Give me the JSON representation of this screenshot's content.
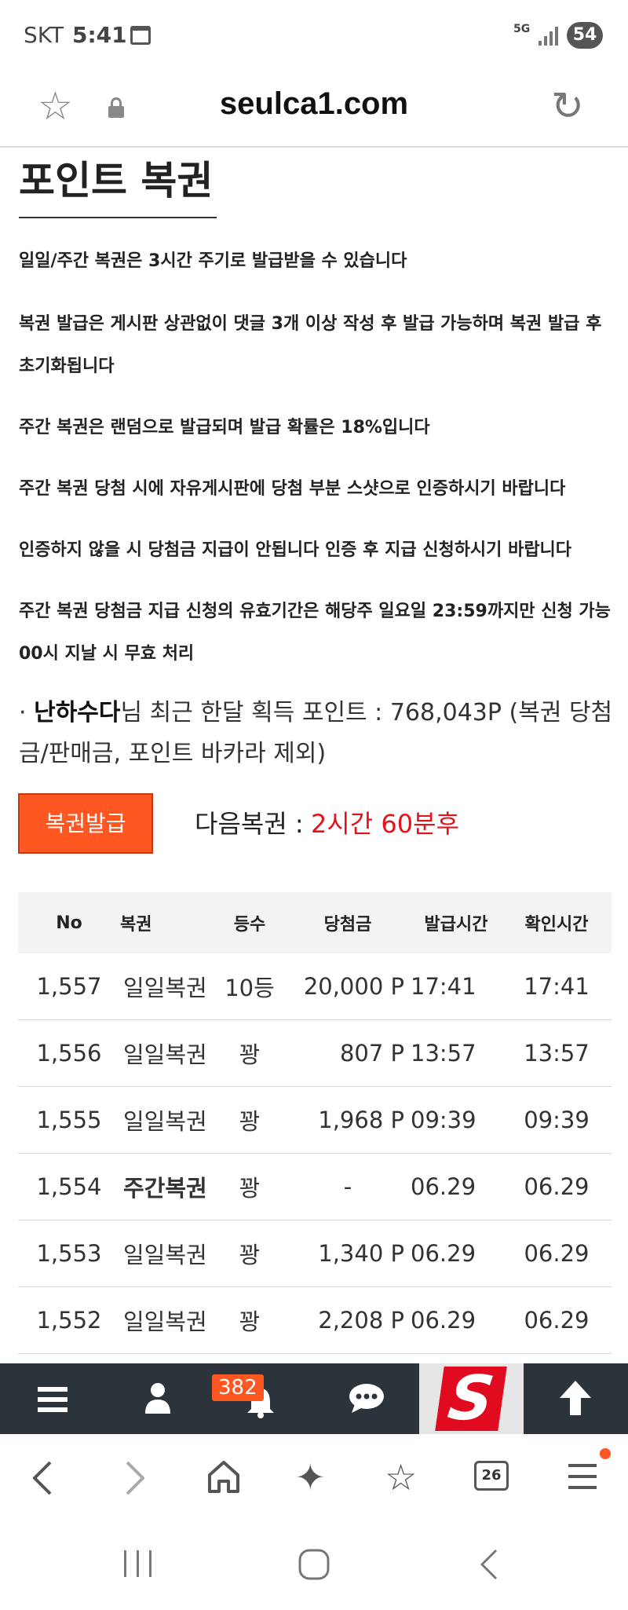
{
  "status": {
    "carrier": "SKT",
    "time": "5:41",
    "network": "5G",
    "battery": "54"
  },
  "browser": {
    "url": "seulca1.com"
  },
  "page": {
    "title": "포인트 복권",
    "notices": [
      "일일/주간 복권은 3시간 주기로 발급받을 수 있습니다",
      "복권 발급은 게시판 상관없이 댓글 3개 이상 작성 후 발급 가능하며 복권 발급 후 초기화됩니다",
      "주간 복권은 랜덤으로 발급되며 발급 확률은 18%입니다",
      "주간 복권 당첨 시에 자유게시판에 당첨 부분 스샷으로 인증하시기 바랍니다",
      "인증하지 않을 시 당첨금 지급이 안됩니다 인증 후 지급 신청하시기 바랍니다",
      "주간 복권 당첨금 지급 신청의 유효기간은 해당주 일요일 23:59까지만 신청 가능 00시 지날 시 무효 처리"
    ],
    "points": {
      "bullet": "·",
      "username": "난하수다",
      "text": "님 최근 한달 획득 포인트 : 768,043P (복권 당첨금/판매금, 포인트 바카라 제외)"
    },
    "issue_button": "복권발급",
    "next_label": "다음복권 :",
    "next_value": "2시간 60분후"
  },
  "table": {
    "headers": {
      "no": "No",
      "ticket": "복권",
      "rank": "등수",
      "prize": "당첨금",
      "issued": "발급시간",
      "checked": "확인시간"
    },
    "rows": [
      {
        "no": "1,557",
        "ticket": "일일복권",
        "rank": "10등",
        "prize": "20,000 P",
        "issued": "17:41",
        "checked": "17:41"
      },
      {
        "no": "1,556",
        "ticket": "일일복권",
        "rank": "꽝",
        "prize": "807 P",
        "issued": "13:57",
        "checked": "13:57"
      },
      {
        "no": "1,555",
        "ticket": "일일복권",
        "rank": "꽝",
        "prize": "1,968 P",
        "issued": "09:39",
        "checked": "09:39"
      },
      {
        "no": "1,554",
        "ticket": "주간복권",
        "rank": "꽝",
        "prize": "-",
        "issued": "06.29",
        "checked": "06.29"
      },
      {
        "no": "1,553",
        "ticket": "일일복권",
        "rank": "꽝",
        "prize": "1,340 P",
        "issued": "06.29",
        "checked": "06.29"
      },
      {
        "no": "1,552",
        "ticket": "일일복권",
        "rank": "꽝",
        "prize": "2,208 P",
        "issued": "06.29",
        "checked": "06.29"
      }
    ]
  },
  "site_toolbar": {
    "notification_count": "382",
    "logo_letter": "S",
    "icons": [
      "menu-icon",
      "user-icon",
      "bell-icon",
      "chat-icon",
      "site-logo",
      "arrow-up-icon"
    ]
  },
  "browser_nav": {
    "tab_count": "26",
    "icons": [
      "back-icon",
      "forward-icon",
      "home-icon",
      "sparkle-icon",
      "bookmarks-icon",
      "tabs-icon",
      "menu-icon"
    ]
  },
  "colors": {
    "accent": "#ff5722",
    "next_value": "#e3121b",
    "toolbar_bg": "#2d333b",
    "logo_red": "#e00b1f"
  }
}
